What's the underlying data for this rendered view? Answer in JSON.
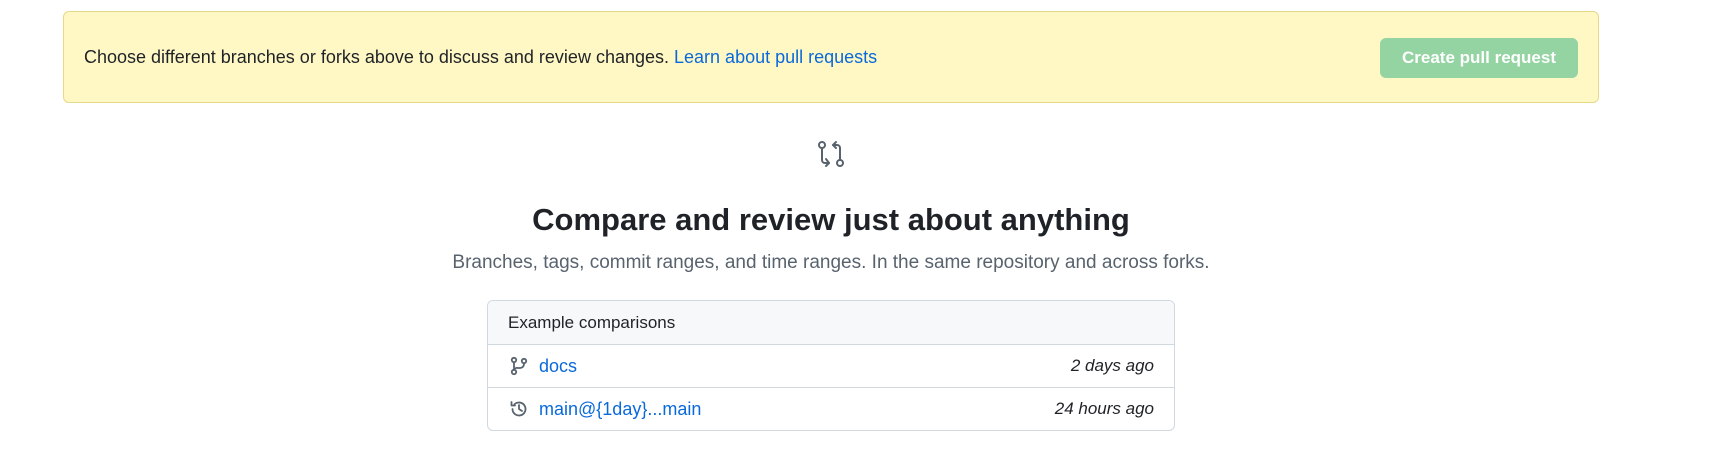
{
  "flash": {
    "message": "Choose different branches or forks above to discuss and review changes.",
    "link_label": "Learn about pull requests",
    "button_label": "Create pull request"
  },
  "blankslate": {
    "icon": "git-compare-icon",
    "title": "Compare and review just about anything",
    "description": "Branches, tags, commit ranges, and time ranges. In the same repository and across forks."
  },
  "examples": {
    "header": "Example comparisons",
    "rows": [
      {
        "icon": "git-branch-icon",
        "label": "docs",
        "time": "2 days ago"
      },
      {
        "icon": "history-icon",
        "label": "main@{1day}...main",
        "time": "24 hours ago"
      }
    ]
  },
  "colors": {
    "flash_bg": "#fff8c5",
    "link": "#0969da",
    "button_disabled": "#94d3a2"
  }
}
